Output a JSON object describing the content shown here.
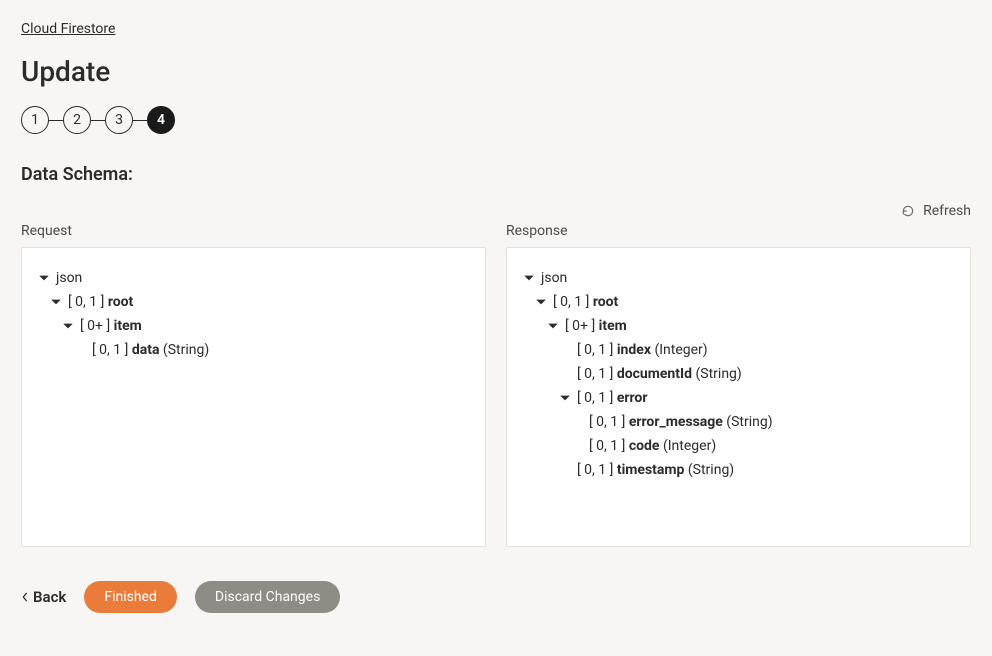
{
  "breadcrumb": {
    "label": "Cloud Firestore"
  },
  "page": {
    "title": "Update"
  },
  "stepper": {
    "steps": [
      "1",
      "2",
      "3",
      "4"
    ],
    "active_index": 3
  },
  "section": {
    "title": "Data Schema:"
  },
  "refresh": {
    "label": "Refresh"
  },
  "columns": {
    "request": {
      "label": "Request"
    },
    "response": {
      "label": "Response"
    }
  },
  "request_tree": {
    "root_label": "json",
    "root": {
      "card": "[ 0, 1 ]",
      "name": "root"
    },
    "item": {
      "card": "[ 0+ ]",
      "name": "item"
    },
    "data": {
      "card": "[ 0, 1 ]",
      "name": "data",
      "type": "(String)"
    }
  },
  "response_tree": {
    "root_label": "json",
    "root": {
      "card": "[ 0, 1 ]",
      "name": "root"
    },
    "item": {
      "card": "[ 0+ ]",
      "name": "item"
    },
    "index": {
      "card": "[ 0, 1 ]",
      "name": "index",
      "type": "(Integer)"
    },
    "documentId": {
      "card": "[ 0, 1 ]",
      "name": "documentId",
      "type": "(String)"
    },
    "error": {
      "card": "[ 0, 1 ]",
      "name": "error"
    },
    "error_message": {
      "card": "[ 0, 1 ]",
      "name": "error_message",
      "type": "(String)"
    },
    "code": {
      "card": "[ 0, 1 ]",
      "name": "code",
      "type": "(Integer)"
    },
    "timestamp": {
      "card": "[ 0, 1 ]",
      "name": "timestamp",
      "type": "(String)"
    }
  },
  "footer": {
    "back": "Back",
    "finished": "Finished",
    "discard": "Discard Changes"
  }
}
